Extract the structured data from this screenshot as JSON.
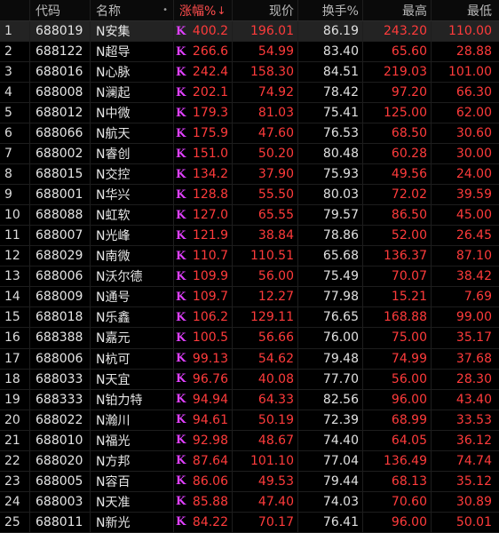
{
  "header": {
    "idx": "",
    "code": "代码",
    "name": "名称",
    "name_icon": "•",
    "chg": "涨幅%",
    "sort_icon": "↓",
    "price": "现价",
    "turnover": "换手%",
    "high": "最高",
    "low": "最低"
  },
  "rows": [
    {
      "idx": "1",
      "code": "688019",
      "name": "N安集",
      "chg": "400.2",
      "price": "196.01",
      "turn": "86.19",
      "high": "243.20",
      "low": "110.00"
    },
    {
      "idx": "2",
      "code": "688122",
      "name": "N超导",
      "chg": "266.6",
      "price": "54.99",
      "turn": "83.40",
      "high": "65.60",
      "low": "28.88"
    },
    {
      "idx": "3",
      "code": "688016",
      "name": "N心脉",
      "chg": "242.4",
      "price": "158.30",
      "turn": "84.51",
      "high": "219.03",
      "low": "101.00"
    },
    {
      "idx": "4",
      "code": "688008",
      "name": "N澜起",
      "chg": "202.1",
      "price": "74.92",
      "turn": "78.42",
      "high": "97.20",
      "low": "66.30"
    },
    {
      "idx": "5",
      "code": "688012",
      "name": "N中微",
      "chg": "179.3",
      "price": "81.03",
      "turn": "75.41",
      "high": "125.00",
      "low": "62.00"
    },
    {
      "idx": "6",
      "code": "688066",
      "name": "N航天",
      "chg": "175.9",
      "price": "47.60",
      "turn": "76.53",
      "high": "68.50",
      "low": "30.60"
    },
    {
      "idx": "7",
      "code": "688002",
      "name": "N睿创",
      "chg": "151.0",
      "price": "50.20",
      "turn": "80.48",
      "high": "60.28",
      "low": "30.00"
    },
    {
      "idx": "8",
      "code": "688015",
      "name": "N交控",
      "chg": "134.2",
      "price": "37.90",
      "turn": "75.93",
      "high": "49.56",
      "low": "24.00"
    },
    {
      "idx": "9",
      "code": "688001",
      "name": "N华兴",
      "chg": "128.8",
      "price": "55.50",
      "turn": "80.03",
      "high": "72.02",
      "low": "39.59"
    },
    {
      "idx": "10",
      "code": "688088",
      "name": "N虹软",
      "chg": "127.0",
      "price": "65.55",
      "turn": "79.57",
      "high": "86.50",
      "low": "45.00"
    },
    {
      "idx": "11",
      "code": "688007",
      "name": "N光峰",
      "chg": "121.9",
      "price": "38.84",
      "turn": "78.86",
      "high": "52.00",
      "low": "26.45"
    },
    {
      "idx": "12",
      "code": "688029",
      "name": "N南微",
      "chg": "110.7",
      "price": "110.51",
      "turn": "65.68",
      "high": "136.37",
      "low": "87.10"
    },
    {
      "idx": "13",
      "code": "688006",
      "name": "N沃尔德",
      "chg": "109.9",
      "price": "56.00",
      "turn": "75.49",
      "high": "70.07",
      "low": "38.42"
    },
    {
      "idx": "14",
      "code": "688009",
      "name": "N通号",
      "chg": "109.7",
      "price": "12.27",
      "turn": "77.98",
      "high": "15.21",
      "low": "7.69"
    },
    {
      "idx": "15",
      "code": "688018",
      "name": "N乐鑫",
      "chg": "106.2",
      "price": "129.11",
      "turn": "76.65",
      "high": "168.88",
      "low": "99.00"
    },
    {
      "idx": "16",
      "code": "688388",
      "name": "N嘉元",
      "chg": "100.5",
      "price": "56.66",
      "turn": "76.00",
      "high": "75.00",
      "low": "35.17"
    },
    {
      "idx": "17",
      "code": "688006",
      "name": "N杭可",
      "chg": "99.13",
      "price": "54.62",
      "turn": "79.48",
      "high": "74.99",
      "low": "37.68"
    },
    {
      "idx": "18",
      "code": "688033",
      "name": "N天宜",
      "chg": "96.76",
      "price": "40.08",
      "turn": "77.70",
      "high": "56.00",
      "low": "28.30"
    },
    {
      "idx": "19",
      "code": "688333",
      "name": "N铂力特",
      "chg": "94.94",
      "price": "64.33",
      "turn": "82.56",
      "high": "96.00",
      "low": "43.40"
    },
    {
      "idx": "20",
      "code": "688022",
      "name": "N瀚川",
      "chg": "94.61",
      "price": "50.19",
      "turn": "72.39",
      "high": "68.99",
      "low": "33.53"
    },
    {
      "idx": "21",
      "code": "688010",
      "name": "N福光",
      "chg": "92.98",
      "price": "48.67",
      "turn": "74.40",
      "high": "64.05",
      "low": "36.12"
    },
    {
      "idx": "22",
      "code": "688020",
      "name": "N方邦",
      "chg": "87.64",
      "price": "101.10",
      "turn": "77.04",
      "high": "136.49",
      "low": "74.74"
    },
    {
      "idx": "23",
      "code": "688005",
      "name": "N容百",
      "chg": "86.06",
      "price": "49.53",
      "turn": "79.44",
      "high": "68.13",
      "low": "35.12"
    },
    {
      "idx": "24",
      "code": "688003",
      "name": "N天准",
      "chg": "85.88",
      "price": "47.40",
      "turn": "74.03",
      "high": "70.60",
      "low": "30.89"
    },
    {
      "idx": "25",
      "code": "688011",
      "name": "N新光",
      "chg": "84.22",
      "price": "70.17",
      "turn": "76.41",
      "high": "96.00",
      "low": "50.01"
    }
  ],
  "flag_glyph": "K",
  "colors": {
    "up": "#ff3b3b",
    "flag": "#e040ff",
    "bg": "#000000",
    "selected_row": "#232323"
  }
}
